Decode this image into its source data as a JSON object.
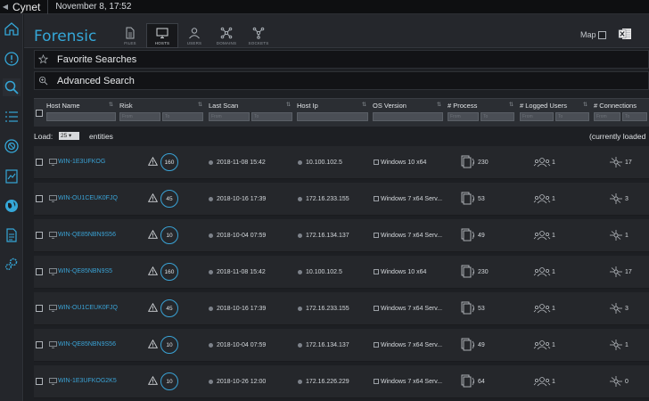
{
  "app": {
    "brand": "Cynet",
    "datetime": "November 8, 17:52"
  },
  "page": {
    "title": "Forensic"
  },
  "tabs": [
    {
      "label": "FILES",
      "icon": "file-icon",
      "active": false
    },
    {
      "label": "HOSTS",
      "icon": "monitor-icon",
      "active": true
    },
    {
      "label": "USERS",
      "icon": "user-icon",
      "active": false
    },
    {
      "label": "DOMAINS",
      "icon": "network-icon",
      "active": false
    },
    {
      "label": "SOCKETS",
      "icon": "socket-icon",
      "active": false
    }
  ],
  "toolbar": {
    "map_label": "Map",
    "export_icon": "excel-icon"
  },
  "sections": {
    "favorite_searches": "Favorite Searches",
    "advanced_search": "Advanced Search"
  },
  "columns": [
    {
      "label": "Host Name",
      "filters": [
        ""
      ]
    },
    {
      "label": "Risk",
      "filters": [
        "From",
        "To"
      ]
    },
    {
      "label": "Last Scan",
      "filters": [
        "From",
        "To"
      ]
    },
    {
      "label": "Host Ip",
      "filters": [
        ""
      ]
    },
    {
      "label": "OS Version",
      "filters": [
        ""
      ]
    },
    {
      "label": "# Process",
      "filters": [
        "From",
        "To"
      ]
    },
    {
      "label": "# Logged Users",
      "filters": [
        "From",
        "To"
      ]
    },
    {
      "label": "# Connections",
      "filters": [
        "From",
        "To"
      ]
    }
  ],
  "load": {
    "label": "Load:",
    "value": "25",
    "suffix": "entities",
    "status": "(currently loaded"
  },
  "rows": [
    {
      "host": "WIN-1E3UFKOG",
      "risk": "160",
      "last_scan": "2018-11-08 15:42",
      "ip": "10.100.102.5",
      "os": "Windows 10 x64",
      "process": "230",
      "users": "1",
      "connections": "17"
    },
    {
      "host": "WIN-OU1CEUK0FJQ",
      "risk": "45",
      "last_scan": "2018-10-16 17:39",
      "ip": "172.16.233.155",
      "os": "Windows 7 x64 Serv...",
      "process": "53",
      "users": "1",
      "connections": "3"
    },
    {
      "host": "WIN-QE85NBN9S56",
      "risk": "10",
      "last_scan": "2018-10-04 07:59",
      "ip": "172.16.134.137",
      "os": "Windows 7 x64 Serv...",
      "process": "49",
      "users": "1",
      "connections": "1"
    },
    {
      "host": "WIN-QE85NBN9S5",
      "risk": "160",
      "last_scan": "2018-11-08 15:42",
      "ip": "10.100.102.5",
      "os": "Windows 10 x64",
      "process": "230",
      "users": "1",
      "connections": "17"
    },
    {
      "host": "WIN-OU1CEUK0FJQ",
      "risk": "45",
      "last_scan": "2018-10-16 17:39",
      "ip": "172.16.233.155",
      "os": "Windows 7 x64 Serv...",
      "process": "53",
      "users": "1",
      "connections": "3"
    },
    {
      "host": "WIN-QE85NBN9S56",
      "risk": "10",
      "last_scan": "2018-10-04 07:59",
      "ip": "172.16.134.137",
      "os": "Windows 7 x64 Serv...",
      "process": "49",
      "users": "1",
      "connections": "1"
    },
    {
      "host": "WIN-1E3UFKOG2K5",
      "risk": "10",
      "last_scan": "2018-10-26 12:00",
      "ip": "172.16.226.229",
      "os": "Windows 7 x64 Serv...",
      "process": "64",
      "users": "1",
      "connections": "0"
    }
  ],
  "sidebar": [
    {
      "icon": "home-icon"
    },
    {
      "icon": "alert-icon"
    },
    {
      "icon": "search-icon",
      "active": true
    },
    {
      "icon": "list-icon"
    },
    {
      "icon": "shield-icon"
    },
    {
      "icon": "report-icon"
    },
    {
      "icon": "globe-icon"
    },
    {
      "icon": "document-icon"
    },
    {
      "icon": "settings-icon"
    }
  ],
  "colors": {
    "accent": "#35a7d8",
    "background": "#1d1f23",
    "row": "#25272b"
  }
}
